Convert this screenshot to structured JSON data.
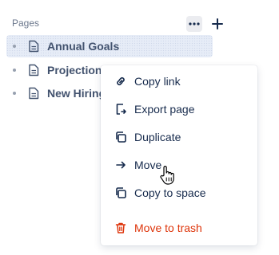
{
  "sidebar": {
    "section_title": "Pages",
    "actions": {
      "more_icon": "more-horizontal-icon",
      "add_icon": "plus-icon"
    },
    "pages": [
      {
        "label": "Annual Goals",
        "active": true
      },
      {
        "label": "Projections",
        "active": false
      },
      {
        "label": "New Hiring",
        "active": false
      }
    ]
  },
  "context_menu": {
    "items": [
      {
        "label": "Copy link",
        "icon": "link-icon"
      },
      {
        "label": "Export page",
        "icon": "export-icon"
      },
      {
        "label": "Duplicate",
        "icon": "duplicate-icon"
      },
      {
        "label": "Move",
        "icon": "arrow-right-icon"
      },
      {
        "label": "Copy to space",
        "icon": "copy-icon"
      },
      {
        "label": "Move to trash",
        "icon": "trash-icon",
        "danger": true
      }
    ]
  },
  "colors": {
    "danger": "#de350b",
    "active_bg": "#e6ecf7",
    "text": "#172b4d"
  }
}
